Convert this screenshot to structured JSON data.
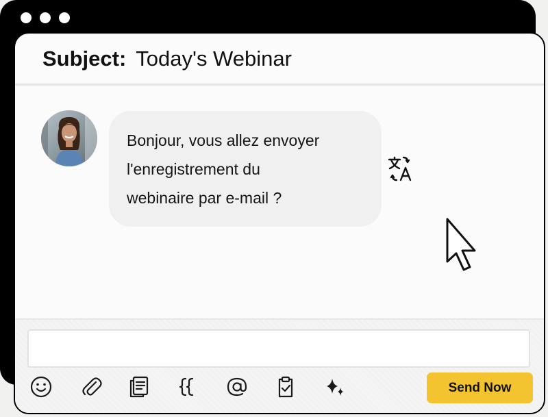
{
  "window": {
    "dots": [
      "dot",
      "dot",
      "dot"
    ]
  },
  "email": {
    "subject_label": "Subject:",
    "subject_value": "Today's Webinar"
  },
  "message": {
    "lines": [
      "Bonjour, vous allez envoyer",
      "l'enregistrement du",
      "webinaire par e-mail ?"
    ]
  },
  "toolbar": {
    "icons": [
      "emoji-icon",
      "attachment-icon",
      "document-icon",
      "variables-icon",
      "mention-icon",
      "clipboard-check-icon",
      "sparkles-icon"
    ],
    "send_label": "Send Now"
  },
  "colors": {
    "accent": "#f4c430",
    "bubble": "#f0f0f0",
    "frame": "#000000"
  }
}
